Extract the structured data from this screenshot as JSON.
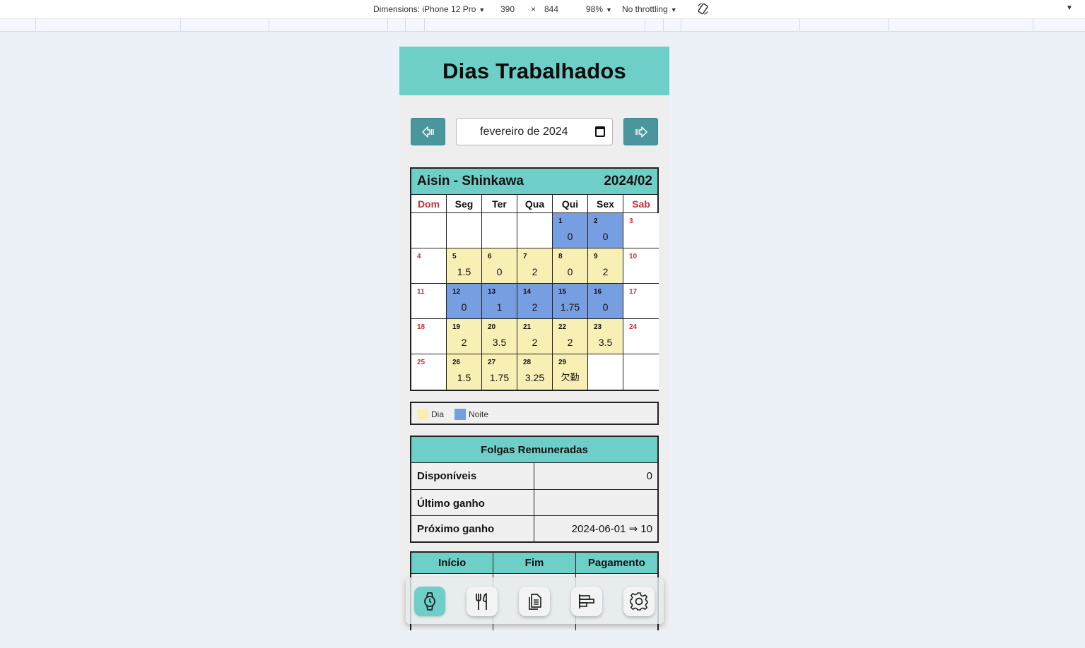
{
  "devtools": {
    "dimensions_label": "Dimensions: iPhone 12 Pro",
    "width": "390",
    "times": "×",
    "height": "844",
    "zoom": "98%",
    "throttling": "No throttling"
  },
  "app": {
    "title": "Dias Trabalhados",
    "month_picker": {
      "value": "fevereiro de 2024"
    },
    "calendar": {
      "company": "Aisin - Shinkawa",
      "period": "2024/02",
      "weekdays": [
        "Dom",
        "Seg",
        "Ter",
        "Qua",
        "Qui",
        "Sex",
        "Sab"
      ],
      "days": [
        {
          "day": "",
          "hours": "",
          "shift": "",
          "weekend": false
        },
        {
          "day": "",
          "hours": "",
          "shift": "",
          "weekend": false
        },
        {
          "day": "",
          "hours": "",
          "shift": "",
          "weekend": false
        },
        {
          "day": "",
          "hours": "",
          "shift": "",
          "weekend": false
        },
        {
          "day": "1",
          "hours": "0",
          "shift": "noite",
          "weekend": false
        },
        {
          "day": "2",
          "hours": "0",
          "shift": "noite",
          "weekend": false
        },
        {
          "day": "3",
          "hours": "",
          "shift": "",
          "weekend": true
        },
        {
          "day": "4",
          "hours": "",
          "shift": "",
          "weekend": true
        },
        {
          "day": "5",
          "hours": "1.5",
          "shift": "dia",
          "weekend": false
        },
        {
          "day": "6",
          "hours": "0",
          "shift": "dia",
          "weekend": false
        },
        {
          "day": "7",
          "hours": "2",
          "shift": "dia",
          "weekend": false
        },
        {
          "day": "8",
          "hours": "0",
          "shift": "dia",
          "weekend": false
        },
        {
          "day": "9",
          "hours": "2",
          "shift": "dia",
          "weekend": false
        },
        {
          "day": "10",
          "hours": "",
          "shift": "",
          "weekend": true
        },
        {
          "day": "11",
          "hours": "",
          "shift": "",
          "weekend": true
        },
        {
          "day": "12",
          "hours": "0",
          "shift": "noite",
          "weekend": false
        },
        {
          "day": "13",
          "hours": "1",
          "shift": "noite",
          "weekend": false
        },
        {
          "day": "14",
          "hours": "2",
          "shift": "noite",
          "weekend": false
        },
        {
          "day": "15",
          "hours": "1.75",
          "shift": "noite",
          "weekend": false
        },
        {
          "day": "16",
          "hours": "0",
          "shift": "noite",
          "weekend": false
        },
        {
          "day": "17",
          "hours": "",
          "shift": "",
          "weekend": true
        },
        {
          "day": "18",
          "hours": "",
          "shift": "",
          "weekend": true
        },
        {
          "day": "19",
          "hours": "2",
          "shift": "dia",
          "weekend": false
        },
        {
          "day": "20",
          "hours": "3.5",
          "shift": "dia",
          "weekend": false
        },
        {
          "day": "21",
          "hours": "2",
          "shift": "dia",
          "weekend": false
        },
        {
          "day": "22",
          "hours": "2",
          "shift": "dia",
          "weekend": false
        },
        {
          "day": "23",
          "hours": "3.5",
          "shift": "dia",
          "weekend": false
        },
        {
          "day": "24",
          "hours": "",
          "shift": "",
          "weekend": true
        },
        {
          "day": "25",
          "hours": "",
          "shift": "",
          "weekend": true
        },
        {
          "day": "26",
          "hours": "1.5",
          "shift": "dia",
          "weekend": false
        },
        {
          "day": "27",
          "hours": "1.75",
          "shift": "dia",
          "weekend": false
        },
        {
          "day": "28",
          "hours": "3.25",
          "shift": "dia",
          "weekend": false
        },
        {
          "day": "29",
          "hours": "欠勤",
          "shift": "dia",
          "weekend": false
        },
        {
          "day": "",
          "hours": "",
          "shift": "",
          "weekend": false
        },
        {
          "day": "",
          "hours": "",
          "shift": "",
          "weekend": false
        }
      ]
    },
    "legend": {
      "dia": "Dia",
      "noite": "Noite"
    },
    "folgas": {
      "title": "Folgas Remuneradas",
      "disponiveis_label": "Disponíveis",
      "disponiveis_value": "0",
      "ultimo_label": "Último ganho",
      "ultimo_value": "",
      "proximo_label": "Próximo ganho",
      "proximo_value": "2024-06-01 ⇒ 10"
    },
    "periods": {
      "headers": [
        "Início",
        "Fim",
        "Pagamento"
      ]
    },
    "bottom_nav": [
      "watch-icon",
      "fork-knife-icon",
      "documents-icon",
      "chart-icon",
      "gear-icon"
    ]
  },
  "colors": {
    "teal": "#6ecfc8",
    "nav_button": "#49969d",
    "dia": "#f8efb5",
    "noite": "#779ee0",
    "weekend_red": "#c6303a"
  }
}
